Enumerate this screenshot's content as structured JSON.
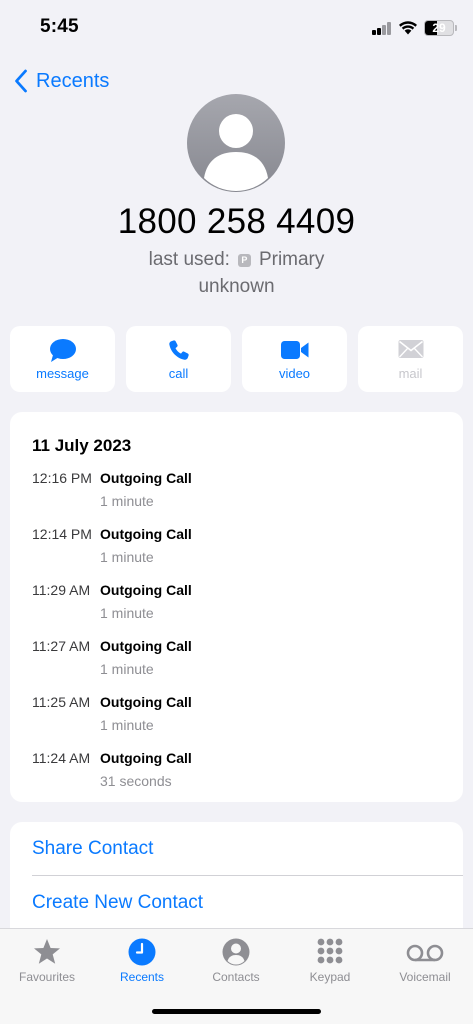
{
  "status_bar": {
    "time": "5:45",
    "battery_level": "29"
  },
  "nav": {
    "back_label": "Recents"
  },
  "contact": {
    "number": "1800 258 4409",
    "last_used_prefix": "last used:",
    "last_used_badge": "P",
    "last_used_line": "Primary",
    "subtitle": "unknown"
  },
  "actions": [
    {
      "label": "message",
      "icon": "message-icon",
      "enabled": true
    },
    {
      "label": "call",
      "icon": "phone-icon",
      "enabled": true
    },
    {
      "label": "video",
      "icon": "video-icon",
      "enabled": true
    },
    {
      "label": "mail",
      "icon": "mail-icon",
      "enabled": false
    }
  ],
  "history": {
    "date": "11 July 2023",
    "calls": [
      {
        "time": "12:16 PM",
        "type": "Outgoing Call",
        "duration": "1 minute"
      },
      {
        "time": "12:14 PM",
        "type": "Outgoing Call",
        "duration": "1 minute"
      },
      {
        "time": "11:29 AM",
        "type": "Outgoing Call",
        "duration": "1 minute"
      },
      {
        "time": "11:27 AM",
        "type": "Outgoing Call",
        "duration": "1 minute"
      },
      {
        "time": "11:25 AM",
        "type": "Outgoing Call",
        "duration": "1 minute"
      },
      {
        "time": "11:24 AM",
        "type": "Outgoing Call",
        "duration": "31 seconds"
      }
    ]
  },
  "links": {
    "share_contact": "Share Contact",
    "create_new_contact": "Create New Contact"
  },
  "tab_bar": {
    "active": "Recents",
    "tabs": [
      {
        "label": "Favourites",
        "icon": "star-icon"
      },
      {
        "label": "Recents",
        "icon": "clock-icon"
      },
      {
        "label": "Contacts",
        "icon": "person-circle-icon"
      },
      {
        "label": "Keypad",
        "icon": "keypad-icon"
      },
      {
        "label": "Voicemail",
        "icon": "voicemail-icon"
      }
    ]
  },
  "colors": {
    "accent": "#0a7aff",
    "background": "#f2f2f7",
    "secondary_text": "#8e8e93",
    "disabled": "#c7c7cc"
  }
}
